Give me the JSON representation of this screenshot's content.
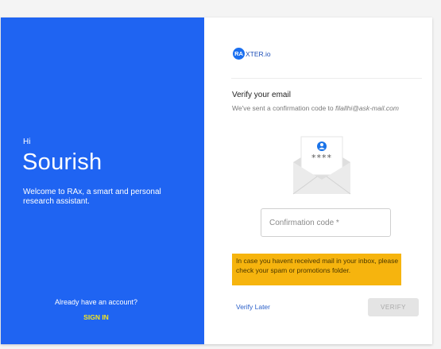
{
  "left_panel": {
    "greeting": "Hi",
    "user_name": "Sourish",
    "welcome_text": "Welcome to RAx, a smart and personal research assistant.",
    "have_account_text": "Already have an account?",
    "sign_in_label": "SIGN IN"
  },
  "right_panel": {
    "logo": {
      "badge": "RA",
      "text": "XTER.io"
    },
    "title": "Verify your email",
    "subtitle_prefix": "We've sent a confirmation code to ",
    "email": "filallhi@ask-mail.com",
    "envelope_code": "****",
    "confirmation_input": {
      "placeholder": "Confirmation code *",
      "value": ""
    },
    "notice": "In case you havent received mail in your inbox, please check your spam or promotions folder.",
    "verify_later_label": "Verify Later",
    "verify_button_label": "VERIFY"
  },
  "colors": {
    "panel_blue": "#1f64f2",
    "sign_in_yellow": "#f5e51e",
    "notice_amber": "#f6b40e",
    "link_blue": "#2a5fc9"
  },
  "icons": [
    "user-avatar-icon",
    "envelope-icon"
  ]
}
